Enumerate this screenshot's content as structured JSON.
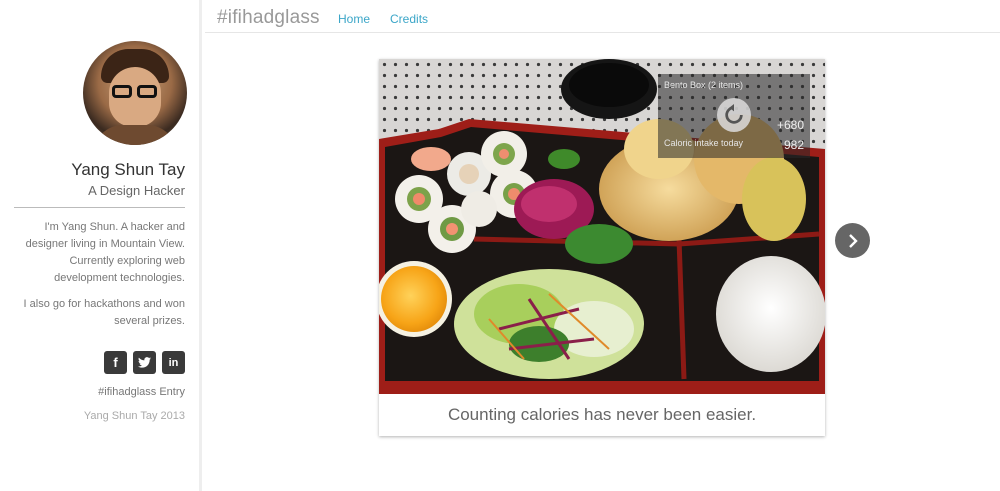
{
  "sidebar": {
    "name": "Yang Shun Tay",
    "tagline": "A Design Hacker",
    "bio": [
      "I'm Yang Shun. A hacker and designer living in Mountain View. Currently exploring web development technologies.",
      "I also go for hackathons and won several prizes."
    ],
    "socials": [
      {
        "icon": "facebook-icon",
        "label": "f"
      },
      {
        "icon": "twitter-icon",
        "label": "t"
      },
      {
        "icon": "linkedin-icon",
        "label": "in"
      }
    ],
    "entry": "#ifihadglass Entry",
    "copyright": "Yang Shun Tay 2013"
  },
  "header": {
    "brand": "#ifihadglass",
    "nav": [
      "Home",
      "Credits"
    ]
  },
  "glass": {
    "title": "Bento Box (2 items)",
    "added": "+680",
    "calorie_label": "Caloric intake today",
    "total": "982"
  },
  "card": {
    "caption": "Counting calories has never been easier."
  },
  "icons": {
    "refresh": "refresh-icon",
    "next": "chevron-right-icon"
  },
  "colors": {
    "accent": "#3ba6c8",
    "social_bg": "#3a3a3a",
    "tray_red": "#b8231c"
  }
}
